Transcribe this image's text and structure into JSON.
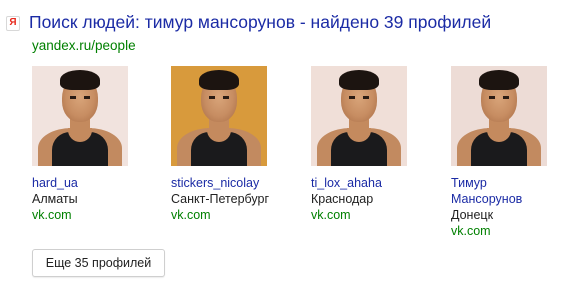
{
  "result": {
    "favicon_glyph": "Я",
    "title": "Поиск людей: тимур мансорунов - найдено 39 профилей",
    "url": "yandex.ru/people"
  },
  "profiles": [
    {
      "name_lines": [
        "hard_ua"
      ],
      "city": "Алматы",
      "site": "vk.com",
      "photo_background": "#f1e3de"
    },
    {
      "name_lines": [
        "stickers_nicolay"
      ],
      "city": "Санкт-Петербург",
      "site": "vk.com",
      "photo_background": "#d89a3c"
    },
    {
      "name_lines": [
        "ti_lox_ahaha"
      ],
      "city": "Краснодар",
      "site": "vk.com",
      "photo_background": "#f0dfd8"
    },
    {
      "name_lines": [
        "Тимур",
        "Мансорунов"
      ],
      "city": "Донецк",
      "site": "vk.com",
      "photo_background": "#eddcd6"
    }
  ],
  "more_button": {
    "label": "Еще 35 профилей"
  },
  "colors": {
    "link": "#1b2ba5",
    "url_green": "#008000",
    "favicon_red": "#e8281c"
  }
}
